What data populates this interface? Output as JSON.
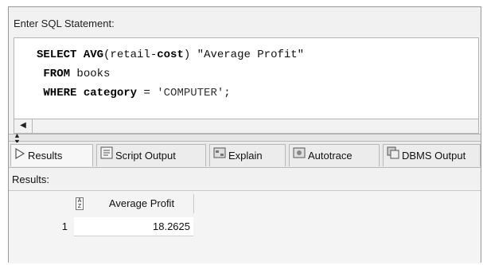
{
  "editor": {
    "label": "Enter SQL Statement:",
    "lines": [
      {
        "k1": "SELECT ",
        "k2": "AVG",
        "t1": "(retail-",
        "k3": "cost",
        "t2": ") \"Average Profit\""
      },
      {
        "k1": "FROM",
        "t1": " books"
      },
      {
        "k1": "WHERE category",
        "t1": " = ",
        "s": "'COMPUTER'",
        "t2": ";"
      }
    ]
  },
  "tabs": [
    {
      "label": "Results",
      "icon": "play-icon"
    },
    {
      "label": "Script Output",
      "icon": "script-icon"
    },
    {
      "label": "Explain",
      "icon": "explain-icon"
    },
    {
      "label": "Autotrace",
      "icon": "autotrace-icon"
    },
    {
      "label": "DBMS Output",
      "icon": "dbms-icon"
    }
  ],
  "results": {
    "label": "Results:",
    "column_header": "Average Profit",
    "rows": [
      {
        "num": "1",
        "value": "18.2625"
      }
    ]
  }
}
